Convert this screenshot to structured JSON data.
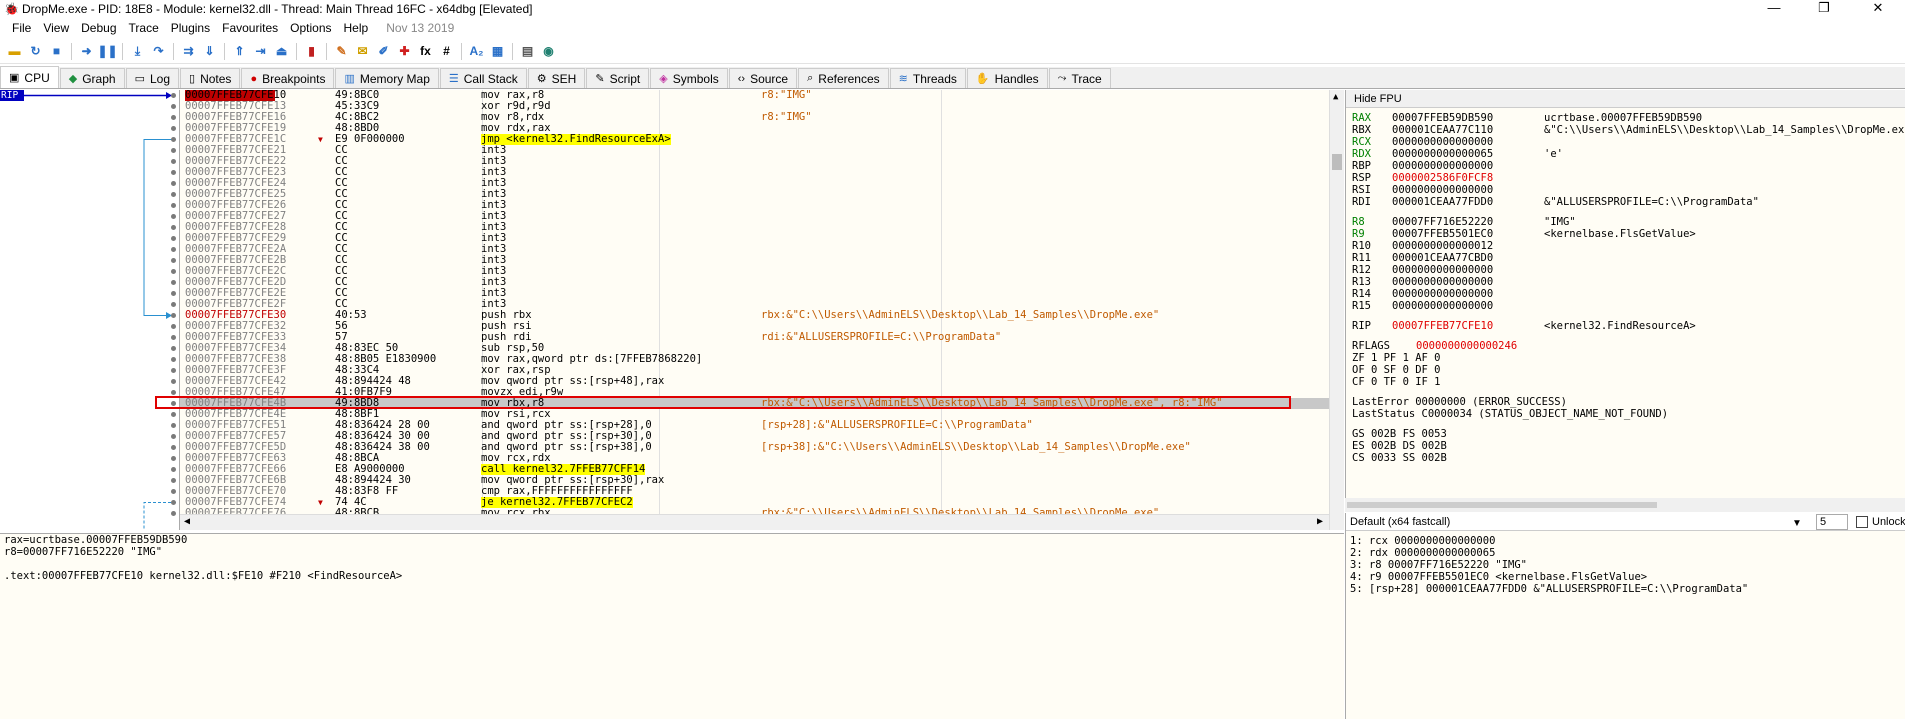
{
  "titlebar": {
    "title": "DropMe.exe - PID: 18E8 - Module: kernel32.dll - Thread: Main Thread 16FC - x64dbg [Elevated]",
    "minimize": "—",
    "maximize": "❐",
    "close": "✕"
  },
  "menu": {
    "items": [
      "File",
      "View",
      "Debug",
      "Trace",
      "Plugins",
      "Favourites",
      "Options",
      "Help"
    ],
    "date": "Nov 13 2019"
  },
  "toolbar": {
    "icons": [
      "open-icon",
      "restart-icon",
      "stop-icon",
      "run-icon",
      "pause-icon",
      "step-into-icon",
      "step-over-icon",
      "trace-into-icon",
      "trace-over-icon",
      "execute-till-return-icon",
      "run-to-user-code-icon",
      "animate-icon",
      "scylla-icon",
      "patch-icon",
      "comments-icon",
      "labels-icon",
      "bookmarks-icon",
      "functions-icon",
      "hash-icon",
      "strings-icon",
      "text-icon",
      "memory-icon",
      "calculator-icon",
      "web-icon"
    ],
    "fx": "fx",
    "hash": "#",
    "az": "A₂"
  },
  "tabs": [
    {
      "label": "CPU",
      "icon": "cpu-icon",
      "active": true
    },
    {
      "label": "Graph",
      "icon": "graph-icon"
    },
    {
      "label": "Log",
      "icon": "log-icon"
    },
    {
      "label": "Notes",
      "icon": "notes-icon"
    },
    {
      "label": "Breakpoints",
      "icon": "breakpoint-icon"
    },
    {
      "label": "Memory Map",
      "icon": "memory-map-icon"
    },
    {
      "label": "Call Stack",
      "icon": "call-stack-icon"
    },
    {
      "label": "SEH",
      "icon": "seh-icon"
    },
    {
      "label": "Script",
      "icon": "script-icon"
    },
    {
      "label": "Symbols",
      "icon": "symbols-icon"
    },
    {
      "label": "Source",
      "icon": "source-icon"
    },
    {
      "label": "References",
      "icon": "references-icon"
    },
    {
      "label": "Threads",
      "icon": "threads-icon"
    },
    {
      "label": "Handles",
      "icon": "handles-icon"
    },
    {
      "label": "Trace",
      "icon": "trace-icon"
    }
  ],
  "rip_label": "RIP",
  "disasm": [
    {
      "addr": "00007FFEB77CFE10",
      "bytes": "49:8BC0",
      "instr": "mov rax,r8",
      "cmt": "r8:\"IMG\"",
      "cur": true
    },
    {
      "addr": "00007FFEB77CFE13",
      "bytes": "45:33C9",
      "instr": "xor r9d,r9d",
      "cmt": ""
    },
    {
      "addr": "00007FFEB77CFE16",
      "bytes": "4C:8BC2",
      "instr": "mov r8,rdx",
      "cmt": "r8:\"IMG\""
    },
    {
      "addr": "00007FFEB77CFE19",
      "bytes": "48:8BD0",
      "instr": "mov rdx,rax",
      "cmt": ""
    },
    {
      "addr": "00007FFEB77CFE1C",
      "bytes": "E9 0F000000",
      "instr": "jmp <kernel32.FindResourceExA>",
      "cmt": "",
      "jmp": true
    },
    {
      "addr": "00007FFEB77CFE21",
      "bytes": "CC",
      "instr": "int3",
      "cmt": ""
    },
    {
      "addr": "00007FFEB77CFE22",
      "bytes": "CC",
      "instr": "int3",
      "cmt": ""
    },
    {
      "addr": "00007FFEB77CFE23",
      "bytes": "CC",
      "instr": "int3",
      "cmt": ""
    },
    {
      "addr": "00007FFEB77CFE24",
      "bytes": "CC",
      "instr": "int3",
      "cmt": ""
    },
    {
      "addr": "00007FFEB77CFE25",
      "bytes": "CC",
      "instr": "int3",
      "cmt": ""
    },
    {
      "addr": "00007FFEB77CFE26",
      "bytes": "CC",
      "instr": "int3",
      "cmt": ""
    },
    {
      "addr": "00007FFEB77CFE27",
      "bytes": "CC",
      "instr": "int3",
      "cmt": ""
    },
    {
      "addr": "00007FFEB77CFE28",
      "bytes": "CC",
      "instr": "int3",
      "cmt": ""
    },
    {
      "addr": "00007FFEB77CFE29",
      "bytes": "CC",
      "instr": "int3",
      "cmt": ""
    },
    {
      "addr": "00007FFEB77CFE2A",
      "bytes": "CC",
      "instr": "int3",
      "cmt": ""
    },
    {
      "addr": "00007FFEB77CFE2B",
      "bytes": "CC",
      "instr": "int3",
      "cmt": ""
    },
    {
      "addr": "00007FFEB77CFE2C",
      "bytes": "CC",
      "instr": "int3",
      "cmt": ""
    },
    {
      "addr": "00007FFEB77CFE2D",
      "bytes": "CC",
      "instr": "int3",
      "cmt": ""
    },
    {
      "addr": "00007FFEB77CFE2E",
      "bytes": "CC",
      "instr": "int3",
      "cmt": ""
    },
    {
      "addr": "00007FFEB77CFE2F",
      "bytes": "CC",
      "instr": "int3",
      "cmt": ""
    },
    {
      "addr": "00007FFEB77CFE30",
      "bytes": "40:53",
      "instr": "push rbx",
      "cmt": "rbx:&\"C:\\\\Users\\\\AdminELS\\\\Desktop\\\\Lab_14_Samples\\\\DropMe.exe\"",
      "red": true
    },
    {
      "addr": "00007FFEB77CFE32",
      "bytes": "56",
      "instr": "push rsi",
      "cmt": ""
    },
    {
      "addr": "00007FFEB77CFE33",
      "bytes": "57",
      "instr": "push rdi",
      "cmt": "rdi:&\"ALLUSERSPROFILE=C:\\\\ProgramData\""
    },
    {
      "addr": "00007FFEB77CFE34",
      "bytes": "48:83EC 50",
      "instr": "sub rsp,50",
      "cmt": ""
    },
    {
      "addr": "00007FFEB77CFE38",
      "bytes": "48:8B05 E1830900",
      "instr": "mov rax,qword ptr ds:[7FFEB7868220]",
      "cmt": ""
    },
    {
      "addr": "00007FFEB77CFE3F",
      "bytes": "48:33C4",
      "instr": "xor rax,rsp",
      "cmt": ""
    },
    {
      "addr": "00007FFEB77CFE42",
      "bytes": "48:894424 48",
      "instr": "mov qword ptr ss:[rsp+48],rax",
      "cmt": ""
    },
    {
      "addr": "00007FFEB77CFE47",
      "bytes": "41:0FB7F9",
      "instr": "movzx edi,r9w",
      "cmt": ""
    },
    {
      "addr": "00007FFEB77CFE4B",
      "bytes": "49:8BD8",
      "instr": "mov rbx,r8",
      "cmt": "rbx:&\"C:\\\\Users\\\\AdminELS\\\\Desktop\\\\Lab_14_Samples\\\\DropMe.exe\", r8:\"IMG\"",
      "hl": true
    },
    {
      "addr": "00007FFEB77CFE4E",
      "bytes": "48:8BF1",
      "instr": "mov rsi,rcx",
      "cmt": ""
    },
    {
      "addr": "00007FFEB77CFE51",
      "bytes": "48:836424 28 00",
      "instr": "and qword ptr ss:[rsp+28],0",
      "cmt": "[rsp+28]:&\"ALLUSERSPROFILE=C:\\\\ProgramData\""
    },
    {
      "addr": "00007FFEB77CFE57",
      "bytes": "48:836424 30 00",
      "instr": "and qword ptr ss:[rsp+30],0",
      "cmt": ""
    },
    {
      "addr": "00007FFEB77CFE5D",
      "bytes": "48:836424 38 00",
      "instr": "and qword ptr ss:[rsp+38],0",
      "cmt": "[rsp+38]:&\"C:\\\\Users\\\\AdminELS\\\\Desktop\\\\Lab_14_Samples\\\\DropMe.exe\""
    },
    {
      "addr": "00007FFEB77CFE63",
      "bytes": "48:8BCA",
      "instr": "mov rcx,rdx",
      "cmt": ""
    },
    {
      "addr": "00007FFEB77CFE66",
      "bytes": "E8 A9000000",
      "instr": "call kernel32.7FFEB77CFF14",
      "cmt": "",
      "call": true
    },
    {
      "addr": "00007FFEB77CFE6B",
      "bytes": "48:894424 30",
      "instr": "mov qword ptr ss:[rsp+30],rax",
      "cmt": ""
    },
    {
      "addr": "00007FFEB77CFE70",
      "bytes": "48:83F8 FF",
      "instr": "cmp rax,FFFFFFFFFFFFFFFF",
      "cmt": ""
    },
    {
      "addr": "00007FFEB77CFE74",
      "bytes": "74 4C",
      "instr": "je kernel32.7FFEB77CFEC2",
      "cmt": "",
      "jmp": true
    },
    {
      "addr": "00007FFEB77CFE76",
      "bytes": "48:8BCB",
      "instr": "mov rcx,rbx",
      "cmt": "rbx:&\"C:\\\\Users\\\\AdminELS\\\\Desktop\\\\Lab_14_Samples\\\\DropMe.exe\""
    }
  ],
  "info": [
    "rax=ucrtbase.00007FFEB59DB590",
    "r8=00007FF716E52220 \"IMG\"",
    "",
    ".text:00007FFEB77CFE10 kernel32.dll:$FE10 #F210 <FindResourceA>"
  ],
  "registers": {
    "hide_label": "Hide FPU",
    "gp": [
      {
        "name": "RAX",
        "value": "00007FFEB59DB590",
        "comment": "ucrtbase.00007FFEB59DB590",
        "changed": true
      },
      {
        "name": "RBX",
        "value": "000001CEAA77C110",
        "comment": "&\"C:\\\\Users\\\\AdminELS\\\\Desktop\\\\Lab_14_Samples\\\\DropMe.exe\""
      },
      {
        "name": "RCX",
        "value": "0000000000000000",
        "comment": ""
      },
      {
        "name": "RDX",
        "value": "0000000000000065",
        "comment": "'e'"
      },
      {
        "name": "RBP",
        "value": "0000000000000000",
        "comment": ""
      },
      {
        "name": "RSP",
        "value": "0000002586F0FCF8",
        "comment": "",
        "valred": true
      },
      {
        "name": "RSI",
        "value": "0000000000000000",
        "comment": ""
      },
      {
        "name": "RDI",
        "value": "000001CEAA77FDD0",
        "comment": "&\"ALLUSERSPROFILE=C:\\\\ProgramData\""
      }
    ],
    "ext": [
      {
        "name": "R8",
        "value": "00007FF716E52220",
        "comment": "\"IMG\""
      },
      {
        "name": "R9",
        "value": "00007FFEB5501EC0",
        "comment": "<kernelbase.FlsGetValue>"
      },
      {
        "name": "R10",
        "value": "0000000000000012",
        "comment": ""
      },
      {
        "name": "R11",
        "value": "000001CEAA77CBD0",
        "comment": ""
      },
      {
        "name": "R12",
        "value": "0000000000000000",
        "comment": ""
      },
      {
        "name": "R13",
        "value": "0000000000000000",
        "comment": ""
      },
      {
        "name": "R14",
        "value": "0000000000000000",
        "comment": ""
      },
      {
        "name": "R15",
        "value": "0000000000000000",
        "comment": ""
      }
    ],
    "rip": {
      "name": "RIP",
      "value": "00007FFEB77CFE10",
      "comment": "<kernel32.FindResourceA>"
    },
    "rflags": {
      "name": "RFLAGS",
      "value": "0000000000000246"
    },
    "flags": [
      "ZF 1  PF 1  AF 0",
      "OF 0  SF 0  DF 0",
      "CF 0  TF 0  IF 1"
    ],
    "lasterror": "LastError  00000000 (ERROR_SUCCESS)",
    "laststatus": "LastStatus C0000034 (STATUS_OBJECT_NAME_NOT_FOUND)",
    "segs": [
      "GS 002B  FS 0053",
      "ES 002B  DS 002B",
      "CS 0033  SS 002B"
    ]
  },
  "callconv": {
    "selected": "Default (x64 fastcall)",
    "count": "5",
    "unlock_label": "Unlock",
    "args": [
      "1: rcx 0000000000000000",
      "2: rdx 0000000000000065",
      "3: r8 00007FF716E52220 \"IMG\"",
      "4: r9 00007FFEB5501EC0 <kernelbase.FlsGetValue>",
      "5: [rsp+28] 000001CEAA77FDD0 &\"ALLUSERSPROFILE=C:\\\\ProgramData\""
    ]
  }
}
